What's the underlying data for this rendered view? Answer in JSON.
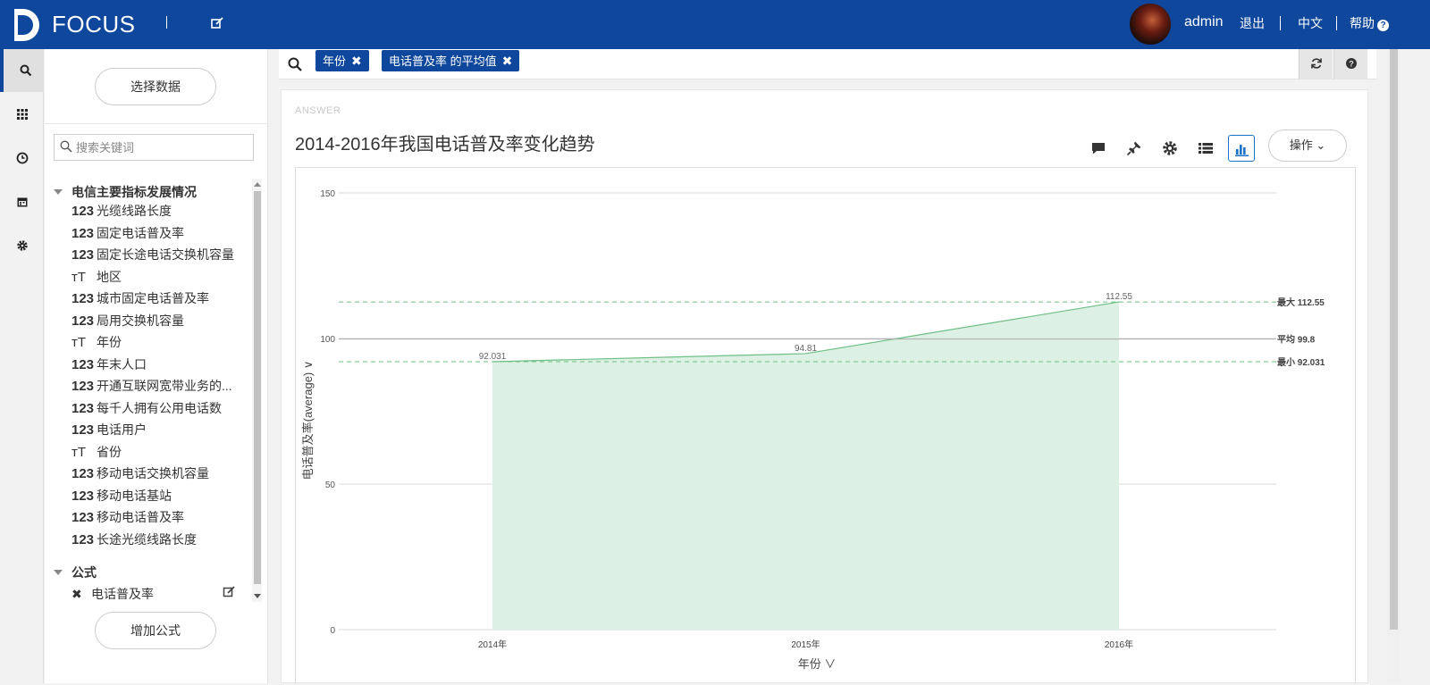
{
  "header": {
    "logo_text": "FOCUS",
    "user_name": "admin",
    "logout": "退出",
    "language": "中文",
    "help": "帮助"
  },
  "nav_rail": {
    "icons": [
      "search-icon",
      "grid-icon",
      "clock-icon",
      "calendar-icon",
      "gear-icon"
    ]
  },
  "side": {
    "select_data_button": "选择数据",
    "search_placeholder": "搜索关键词",
    "group1": {
      "title": "电信主要指标发展情况",
      "fields": [
        {
          "type": "123",
          "name": "光缆线路长度"
        },
        {
          "type": "123",
          "name": "固定电话普及率"
        },
        {
          "type": "123",
          "name": "固定长途电话交换机容量"
        },
        {
          "type": "T",
          "name": "地区"
        },
        {
          "type": "123",
          "name": "城市固定电话普及率"
        },
        {
          "type": "123",
          "name": "局用交换机容量"
        },
        {
          "type": "T",
          "name": "年份"
        },
        {
          "type": "123",
          "name": "年末人口"
        },
        {
          "type": "123",
          "name": "开通互联网宽带业务的..."
        },
        {
          "type": "123",
          "name": "每千人拥有公用电话数"
        },
        {
          "type": "123",
          "name": "电话用户"
        },
        {
          "type": "T",
          "name": "省份"
        },
        {
          "type": "123",
          "name": "移动电话交换机容量"
        },
        {
          "type": "123",
          "name": "移动电话基站"
        },
        {
          "type": "123",
          "name": "移动电话普及率"
        },
        {
          "type": "123",
          "name": "长途光缆线路长度"
        }
      ]
    },
    "group2": {
      "title": "公式",
      "formula": "电话普及率"
    },
    "add_formula_button": "增加公式"
  },
  "search": {
    "chips": [
      {
        "label": "年份"
      },
      {
        "label": "电话普及率 的平均值"
      }
    ]
  },
  "answer": {
    "label": "ANSWER",
    "title": "2014-2016年我国电话普及率变化趋势",
    "operate_button": "操作",
    "accent": "#1a73c9"
  },
  "chart_data": {
    "type": "area",
    "categories": [
      "2014年",
      "2015年",
      "2016年"
    ],
    "series": [
      {
        "values": [
          92.031,
          94.81,
          112.55
        ]
      }
    ],
    "data_labels": [
      "92.031",
      "94.81",
      "112.55"
    ],
    "ylim": [
      0,
      150
    ],
    "yticks": [
      0,
      50,
      100,
      150
    ],
    "ylabel": "电话普及率(average)",
    "xlabel": "年份",
    "reference_lines": [
      {
        "label": "最大 112.55",
        "value": 112.55,
        "style": "dashed"
      },
      {
        "label": "平均 99.8",
        "value": 99.8,
        "style": "solid"
      },
      {
        "label": "最小 92.031",
        "value": 92.031,
        "style": "dashed"
      }
    ],
    "colors": {
      "fill": "#dcf0e3",
      "line": "#6fbf86",
      "ref_dashed": "#6fbf86",
      "ref_solid": "#aaaaaa",
      "grid": "#d9d9d9"
    }
  }
}
